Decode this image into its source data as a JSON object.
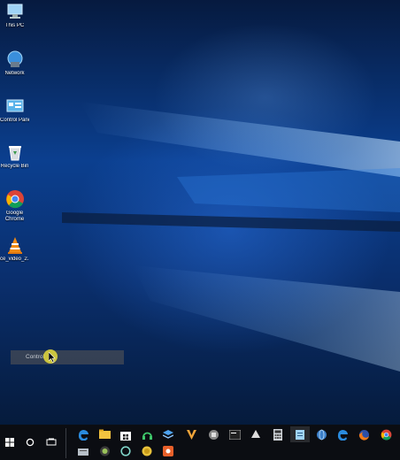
{
  "desktop": {
    "icons": [
      {
        "label": "This PC",
        "icon": "this-pc-icon"
      },
      {
        "label": "Network",
        "icon": "network-icon"
      },
      {
        "label": "Control Panel",
        "icon": "control-panel-icon"
      },
      {
        "label": "Recycle Bin",
        "icon": "recycle-bin-icon"
      },
      {
        "label": "Google Chrome",
        "icon": "chrome-icon"
      },
      {
        "label": "ce_video_2...",
        "icon": "vlc-icon"
      }
    ]
  },
  "search": {
    "text": "Control"
  },
  "taskbar": {
    "start_icon": "windows-start-icon",
    "search_icon": "cortana-circle-icon",
    "taskview_icon": "task-view-icon",
    "apps_row1": [
      "edge-icon",
      "file-explorer-icon",
      "store-icon",
      "headphones-app-icon",
      "vivaldi-icon",
      "media-app-icon",
      "terminal-icon",
      "inkscape-icon",
      "calculator-icon",
      "notepad-icon",
      "globe-icon",
      "edge-icon",
      "firefox-icon",
      "chrome-icon"
    ],
    "apps_row2": [
      "disk-icon",
      "camera-app-icon",
      "circle-app-icon",
      "coin-app-icon",
      "orange-app-icon"
    ]
  },
  "colors": {
    "wallpaper_blue": "#0b3f8f",
    "taskbar": "#0b0d12",
    "cursor_highlight": "#e6dc3c"
  }
}
